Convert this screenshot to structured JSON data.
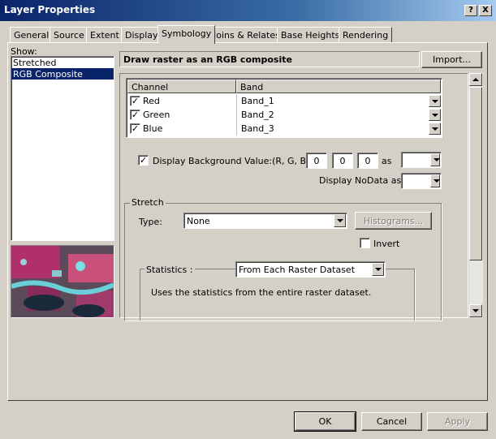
{
  "window": {
    "title": "Layer Properties",
    "help_btn": "?",
    "close_btn": "X"
  },
  "tabs": [
    "General",
    "Source",
    "Extent",
    "Display",
    "Symbology",
    "Joins & Relates",
    "Base Heights",
    "Rendering"
  ],
  "active_tab": "Symbology",
  "show": {
    "label": "Show:",
    "items": [
      "Stretched",
      "RGB Composite"
    ],
    "selected": "RGB Composite"
  },
  "header": {
    "title": "Draw raster as an RGB composite",
    "import_label": "Import..."
  },
  "channels": {
    "col_channel": "Channel",
    "col_band": "Band",
    "rows": [
      {
        "channel": "Red",
        "band": "Band_1",
        "checked": true
      },
      {
        "channel": "Green",
        "band": "Band_2",
        "checked": true
      },
      {
        "channel": "Blue",
        "band": "Band_3",
        "checked": true
      }
    ]
  },
  "background": {
    "label": "Display Background Value:(R, G, B)",
    "r": "0",
    "g": "0",
    "b": "0",
    "as": "as",
    "checked": true
  },
  "nodata": {
    "label": "Display NoData as"
  },
  "stretch": {
    "group_label": "Stretch",
    "type_label": "Type:",
    "type_value": "None",
    "histograms_label": "Histograms...",
    "invert_label": "Invert",
    "statistics_label": "Statistics :",
    "statistics_value": "From Each Raster Dataset",
    "statistics_desc": "Uses the statistics from the entire raster dataset."
  },
  "buttons": {
    "ok": "OK",
    "cancel": "Cancel",
    "apply": "Apply"
  }
}
